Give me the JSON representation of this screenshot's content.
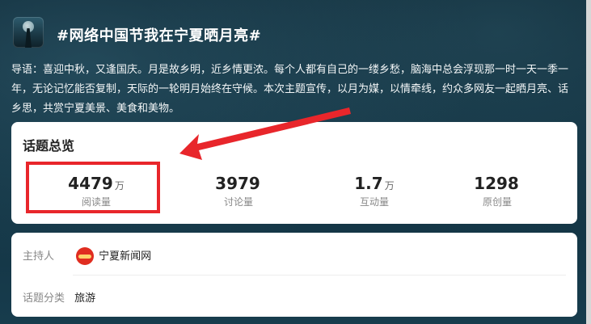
{
  "header": {
    "title": "#网络中国节我在宁夏晒月亮#"
  },
  "intro": {
    "text": "导语：喜迎中秋，又逢国庆。月是故乡明，近乡情更浓。每个人都有自己的一缕乡愁，脑海中总会浮现那一时一天一季一年，无论记忆能否复制，天际的一轮明月始终在守候。本次主题宣传，以月为媒，以情牵线，约众多网友一起晒月亮、话乡思，共赏宁夏美景、美食和美物。"
  },
  "overview": {
    "title": "话题总览",
    "stats": [
      {
        "value": "4479",
        "unit": "万",
        "label": "阅读量"
      },
      {
        "value": "3979",
        "unit": "",
        "label": "讨论量"
      },
      {
        "value": "1.7",
        "unit": "万",
        "label": "互动量"
      },
      {
        "value": "1298",
        "unit": "",
        "label": "原创量"
      }
    ]
  },
  "info": {
    "host_key": "主持人",
    "host_name": "宁夏新闻网",
    "category_key": "话题分类",
    "category_value": "旅游"
  },
  "colors": {
    "highlight": "#e8262b",
    "background": "#123748"
  }
}
